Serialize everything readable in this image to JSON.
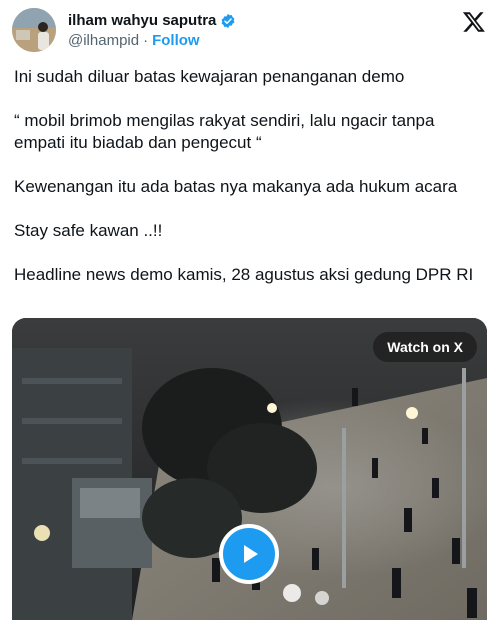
{
  "author": {
    "display_name": "ilham wahyu saputra",
    "handle": "@ilhampid",
    "separator": "·",
    "follow_label": "Follow"
  },
  "tweet": {
    "paragraphs": [
      "Ini sudah diluar batas kewajaran penanganan demo",
      "“ mobil brimob mengilas rakyat sendiri, lalu ngacir tanpa empati itu biadab dan pengecut “",
      "Kewenangan itu ada batas nya makanya ada hukum acara",
      "Stay safe kawan ..!!",
      "Headline news demo kamis, 28 agustus aksi gedung DPR RI"
    ]
  },
  "media": {
    "watch_label": "Watch on X",
    "play_icon": "play-icon"
  },
  "colors": {
    "accent": "#1d9bf0",
    "text": "#0f1419",
    "muted": "#536471"
  }
}
